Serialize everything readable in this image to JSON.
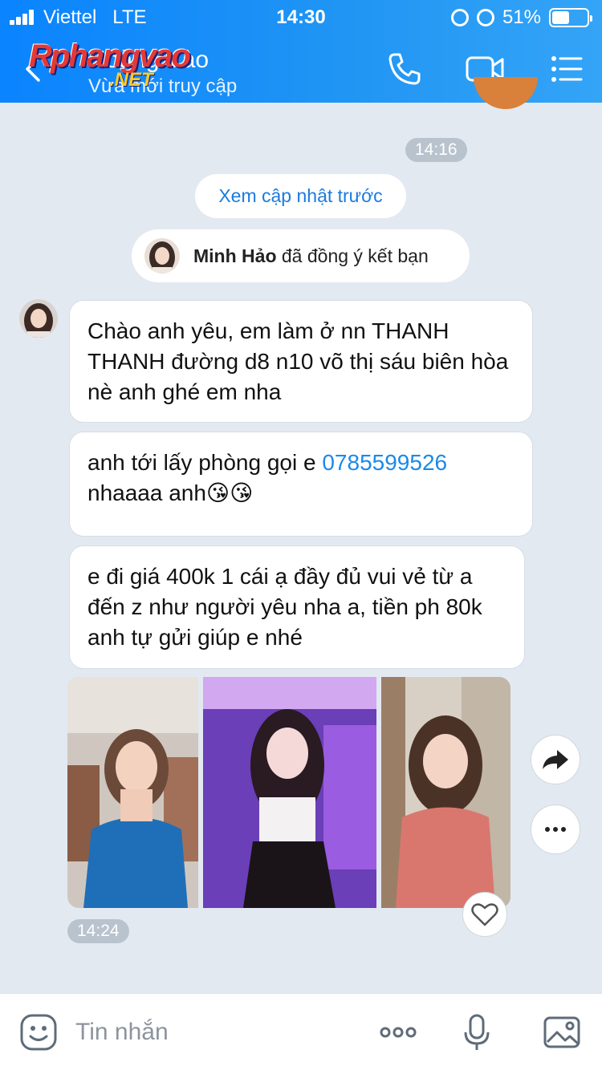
{
  "status_bar": {
    "carrier": "Viettel",
    "network": "LTE",
    "time": "14:30",
    "battery": "51%",
    "battery_level": 0.51
  },
  "header": {
    "contact_name": "Hoàng Vào",
    "status": "Vừa mới truy cập",
    "watermark_main": "Rphang vao",
    "watermark_sub": ".NET",
    "icons": [
      "back-icon",
      "phone-icon",
      "video-call-icon",
      "menu-icon"
    ]
  },
  "chat": {
    "time_top": "14:16",
    "load_previous": "Xem cập nhật trước",
    "friend_notice": {
      "name": "Minh Hảo",
      "text": " đã đồng ý kết bạn"
    },
    "messages": [
      {
        "text": "Chào anh yêu, em làm ở nn THANH THANH đường d8 n10 võ thị sáu biên hòa nè anh ghé em nha"
      },
      {
        "text_before": "anh tới lấy phòng  gọi e ",
        "phone": "0785599526",
        "text_after": "nhaaaa anh😘😘"
      },
      {
        "text": "e đi giá 400k 1 cái ạ đầy đủ vui vẻ từ a đến z như người yêu nha a, tiền ph 80k anh tự gửi giúp e nhé"
      }
    ],
    "photo_count": 3,
    "time_bottom": "14:24"
  },
  "input": {
    "placeholder": "Tin nhắn"
  },
  "colors": {
    "header_gradient_start": "#0a84ff",
    "header_gradient_end": "#34a4f7",
    "chat_background": "#e2e9f1",
    "link": "#1a8ae8"
  }
}
